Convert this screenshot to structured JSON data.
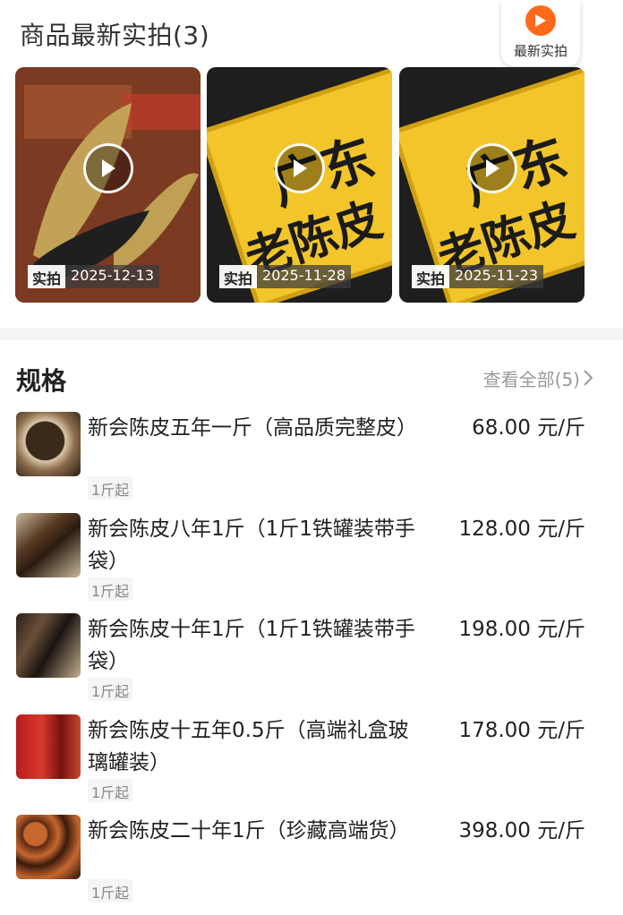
{
  "photos": {
    "title": "商品最新实拍(3)",
    "latest_button_label": "最新实拍",
    "items": [
      {
        "tag": "实拍",
        "date": "2025-12-13"
      },
      {
        "tag": "实拍",
        "date": "2025-11-28",
        "jar_text_1": "广东",
        "jar_text_2": "老陈皮"
      },
      {
        "tag": "实拍",
        "date": "2025-11-23",
        "jar_text_1": "广东",
        "jar_text_2": "老陈皮"
      }
    ]
  },
  "specs": {
    "title": "规格",
    "view_all": "查看全部(5)",
    "items": [
      {
        "name": "新会陈皮五年一斤（高品质完整皮）",
        "price": "68.00 元/斤",
        "min": "1斤起"
      },
      {
        "name": "新会陈皮八年1斤（1斤1铁罐装带手袋）",
        "price": "128.00 元/斤",
        "min": "1斤起"
      },
      {
        "name": "新会陈皮十年1斤（1斤1铁罐装带手袋）",
        "price": "198.00 元/斤",
        "min": "1斤起"
      },
      {
        "name": "新会陈皮十五年0.5斤（高端礼盒玻璃罐装）",
        "price": "178.00 元/斤",
        "min": "1斤起"
      },
      {
        "name": "新会陈皮二十年1斤（珍藏高端货）",
        "price": "398.00 元/斤",
        "min": "1斤起"
      }
    ]
  },
  "colors": {
    "accent": "#ff6a1a",
    "jar_label": "#f2c52a",
    "muted_text": "#9a9a9a"
  }
}
